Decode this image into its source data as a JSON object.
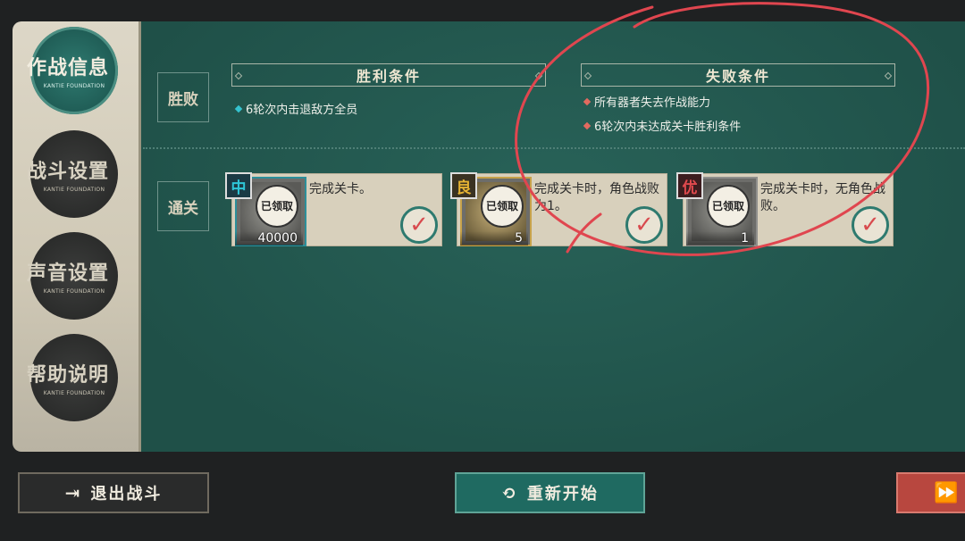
{
  "nav": {
    "subtitle": "KANTIE FOUNDATION",
    "items": [
      {
        "label": "作战信息",
        "active": true
      },
      {
        "label": "战斗设置",
        "active": false
      },
      {
        "label": "声音设置",
        "active": false
      },
      {
        "label": "帮助说明",
        "active": false
      }
    ]
  },
  "sections": {
    "outcome_tag": "胜败",
    "clear_tag": "通关"
  },
  "victory": {
    "header": "胜利条件",
    "conditions": [
      "6轮次内击退敌方全员"
    ]
  },
  "defeat": {
    "header": "失败条件",
    "conditions": [
      "所有器者失去作战能力",
      "6轮次内未达成关卡胜利条件"
    ]
  },
  "rewards": [
    {
      "grade": "中",
      "claimed_text": "已领取",
      "quantity": "40000",
      "text": "完成关卡。",
      "grade_color": "#2ec6d8"
    },
    {
      "grade": "良",
      "claimed_text": "已领取",
      "quantity": "5",
      "text": "完成关卡时，角色战败为1。",
      "grade_color": "#e6b333"
    },
    {
      "grade": "优",
      "claimed_text": "已领取",
      "quantity": "1",
      "text": "完成关卡时，无角色战败。",
      "grade_color": "#e24a4e"
    }
  ],
  "bottom": {
    "exit_label": "退出战斗",
    "restart_label": "重新开始"
  },
  "colors": {
    "panel": "#235a52",
    "accent_red": "#b8473f",
    "annotation": "#e0464f"
  }
}
